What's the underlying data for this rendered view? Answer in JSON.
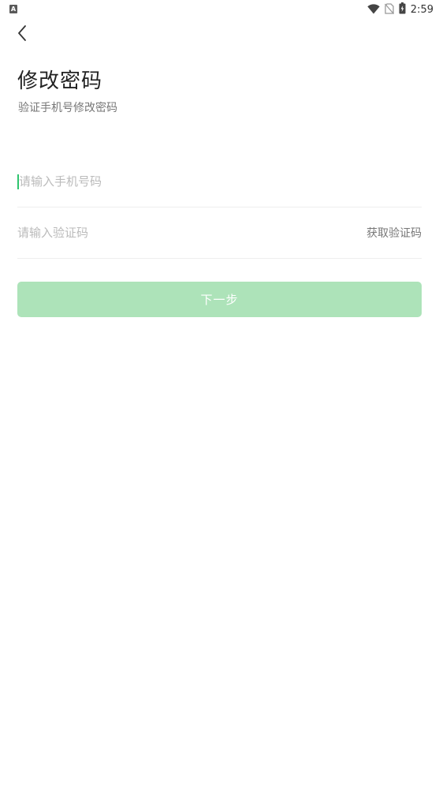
{
  "status_bar": {
    "app_icon_letter": "A",
    "time": "2:59",
    "icons": [
      "wifi-icon",
      "no-sim-icon",
      "battery-charging-icon"
    ]
  },
  "header": {
    "back_icon": "chevron-left-icon",
    "title": "修改密码",
    "subtitle": "验证手机号修改密码"
  },
  "form": {
    "phone": {
      "value": "",
      "placeholder": "请输入手机号码"
    },
    "code": {
      "value": "",
      "placeholder": "请输入验证码",
      "get_code_label": "获取验证码"
    },
    "next_label": "下一步"
  },
  "colors": {
    "accent": "#2ec46e",
    "button_disabled": "#ade3b9",
    "title": "#222222",
    "subtitle": "#777777",
    "placeholder": "#bbbbbb",
    "divider": "#eeeeee"
  }
}
